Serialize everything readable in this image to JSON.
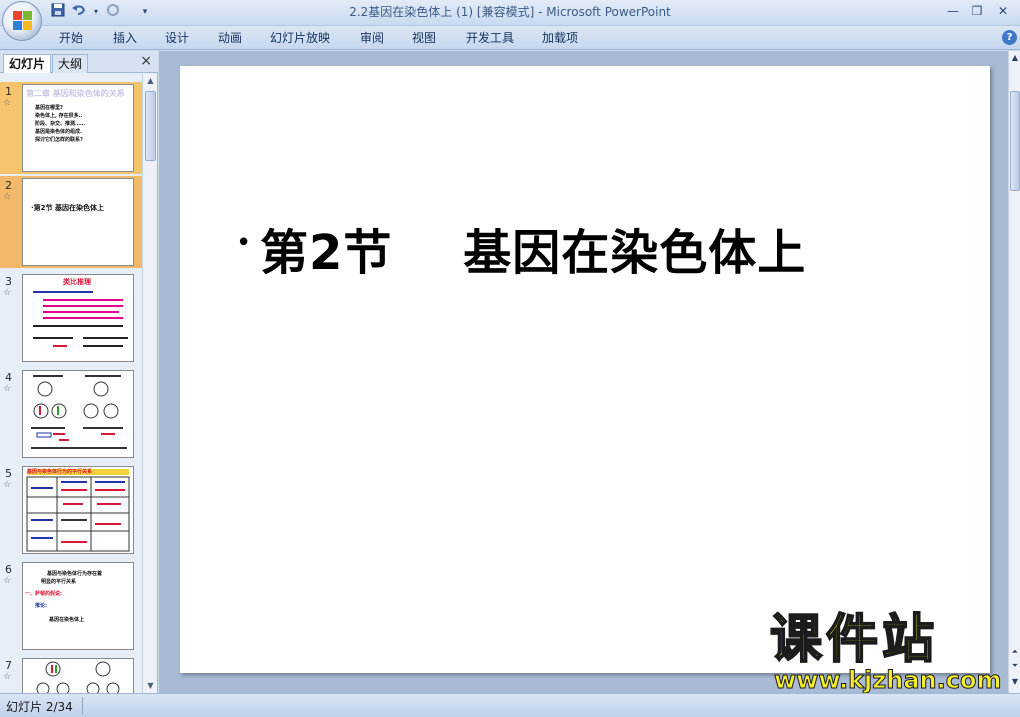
{
  "window": {
    "title": "2.2基因在染色体上 (1) [兼容模式] - ",
    "app_name": "Microsoft PowerPoint",
    "qat_icons": [
      "save-icon",
      "undo-icon",
      "redo-icon",
      "customize-qat-icon"
    ],
    "controls": [
      "minimize-icon",
      "maximize-icon",
      "close-icon"
    ]
  },
  "ribbon": {
    "tabs": [
      "开始",
      "插入",
      "设计",
      "动画",
      "幻灯片放映",
      "审阅",
      "视图",
      "开发工具",
      "加载项"
    ],
    "help_icon": "?"
  },
  "left_panel": {
    "tabs": {
      "slides": "幻灯片",
      "outline": "大纲"
    },
    "close_icon": "×",
    "slides": [
      {
        "num": "1",
        "lines": [
          "第二章  基因和染色体的关系",
          "基因在哪里?",
          "染色体上, 存在很多..",
          "阶段、杂交、推测……",
          "基因是染色体的组成.",
          "探讨它们怎样的联系?"
        ]
      },
      {
        "num": "2",
        "text": "·第2节  基因在染色体上"
      },
      {
        "num": "3",
        "lines": [
          "类比推理"
        ]
      },
      {
        "num": "4",
        "lines": []
      },
      {
        "num": "5",
        "lines": [
          "基因与染色体行为的平行关系"
        ]
      },
      {
        "num": "6",
        "lines": [
          "基因与染色体行为存在着",
          "明显的平行关系",
          "一、萨顿的假说:",
          "推论:",
          "基因在染色体上"
        ]
      },
      {
        "num": "7",
        "lines": []
      }
    ]
  },
  "slide": {
    "bullet": "•",
    "title": "第2节    基因在染色体上"
  },
  "watermark": {
    "main": "课件站",
    "url": "www.kjzhan.com"
  },
  "status": {
    "slide_indicator": "幻灯片 2/34"
  }
}
